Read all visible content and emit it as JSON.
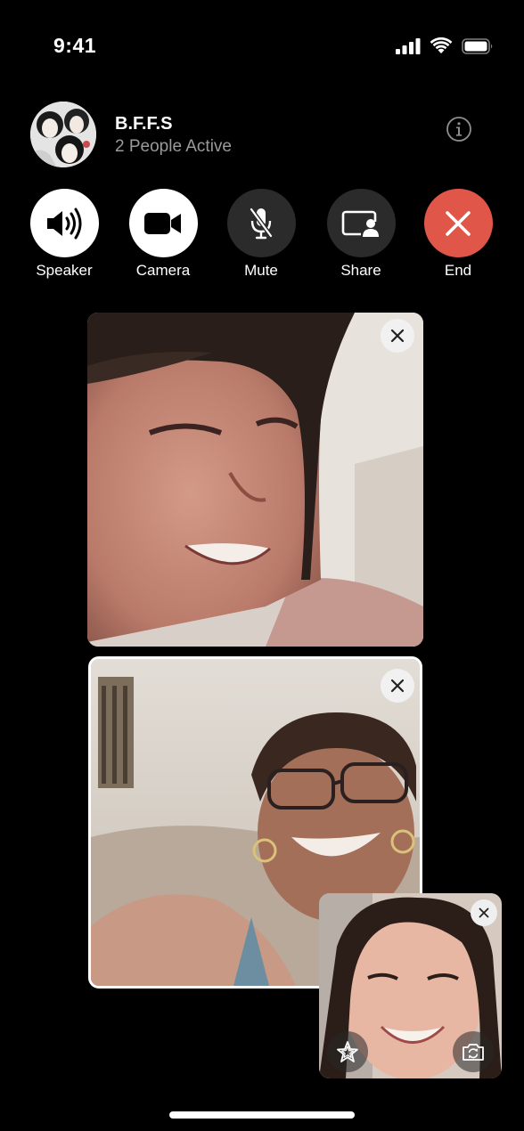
{
  "status_bar": {
    "time": "9:41"
  },
  "group": {
    "name": "B.F.F.S",
    "status": "2 People Active"
  },
  "controls": [
    {
      "label": "Speaker",
      "icon": "speaker-icon"
    },
    {
      "label": "Camera",
      "icon": "video-camera-icon"
    },
    {
      "label": "Mute",
      "icon": "mic-off-icon"
    },
    {
      "label": "Share",
      "icon": "share-screen-icon"
    },
    {
      "label": "End",
      "icon": "close-icon"
    }
  ],
  "colors": {
    "end_call": "#e0574a",
    "control_dark": "#2b2b2b",
    "control_light": "#ffffff",
    "secondary_text": "#9a9a9a"
  }
}
